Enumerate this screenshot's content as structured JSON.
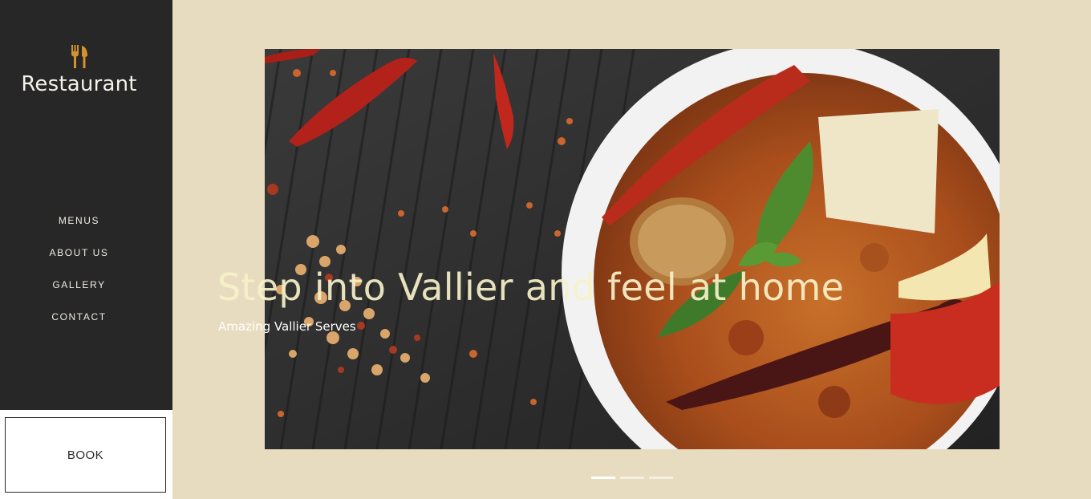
{
  "brand": {
    "name": "Restaurant",
    "icon": "fork-knife-icon",
    "icon_color": "#d4922e"
  },
  "nav": {
    "items": [
      {
        "label": "MENUS"
      },
      {
        "label": "ABOUT US"
      },
      {
        "label": "GALLERY"
      },
      {
        "label": "CONTACT"
      }
    ]
  },
  "book": {
    "label": "BOOK"
  },
  "hero": {
    "title": "Step into Vallier and feel at home",
    "subtitle": "Amazing Vallier Serves",
    "image": "curry-bowl-with-chilies-photo"
  },
  "slider": {
    "count": 3,
    "active": 1
  },
  "colors": {
    "sidebar": "#272727",
    "page_bg": "#e8dcc0",
    "title": "#f7f2c9"
  }
}
